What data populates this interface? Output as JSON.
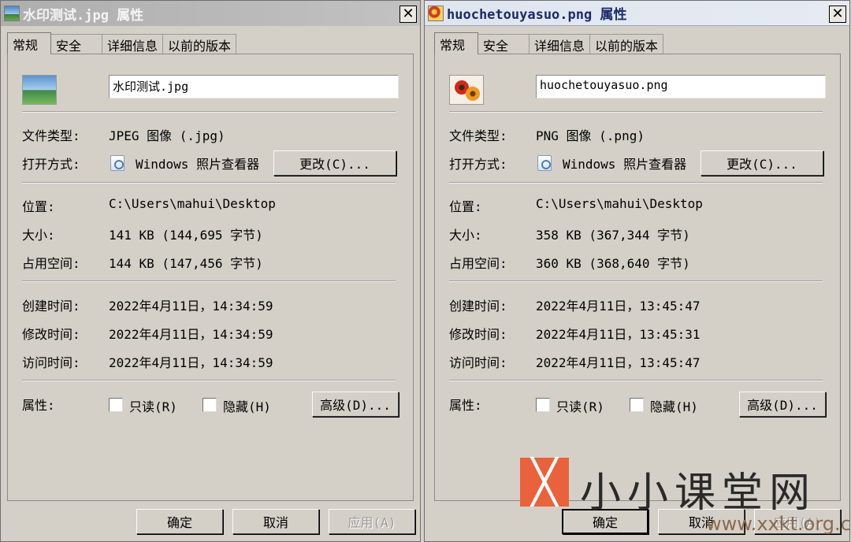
{
  "left_window": {
    "title": "水印测试.jpg 属性",
    "close_label": "✕",
    "tabs": [
      "常规",
      "安全",
      "详细信息",
      "以前的版本"
    ],
    "filename": "水印测试.jpg",
    "file_type_label": "文件类型:",
    "file_type_value": "JPEG 图像 (.jpg)",
    "opens_with_label": "打开方式:",
    "opens_with_value": "Windows 照片查看器",
    "change_button": "更改(C)...",
    "location_label": "位置:",
    "location_value": "C:\\Users\\mahui\\Desktop",
    "size_label": "大小:",
    "size_value": "141 KB (144,695 字节)",
    "size_on_disk_label": "占用空间:",
    "size_on_disk_value": "144 KB (147,456 字节)",
    "created_label": "创建时间:",
    "created_value": "2022年4月11日，14:34:59",
    "modified_label": "修改时间:",
    "modified_value": "2022年4月11日，14:34:59",
    "accessed_label": "访问时间:",
    "accessed_value": "2022年4月11日，14:34:59",
    "attributes_label": "属性:",
    "readonly_label": "只读(R)",
    "hidden_label": "隐藏(H)",
    "advanced_button": "高级(D)...",
    "ok_button": "确定",
    "cancel_button": "取消",
    "apply_button": "应用(A)"
  },
  "right_window": {
    "title": "huochetouyasuo.png 属性",
    "close_label": "✕",
    "tabs": [
      "常规",
      "安全",
      "详细信息",
      "以前的版本"
    ],
    "filename": "huochetouyasuo.png",
    "file_type_label": "文件类型:",
    "file_type_value": "PNG 图像 (.png)",
    "opens_with_label": "打开方式:",
    "opens_with_value": "Windows 照片查看器",
    "change_button": "更改(C)...",
    "location_label": "位置:",
    "location_value": "C:\\Users\\mahui\\Desktop",
    "size_label": "大小:",
    "size_value": "358 KB (367,344 字节)",
    "size_on_disk_label": "占用空间:",
    "size_on_disk_value": "360 KB (368,640 字节)",
    "created_label": "创建时间:",
    "created_value": "2022年4月11日，13:45:47",
    "modified_label": "修改时间:",
    "modified_value": "2022年4月11日，13:45:31",
    "accessed_label": "访问时间:",
    "accessed_value": "2022年4月11日，13:45:47",
    "attributes_label": "属性:",
    "readonly_label": "只读(R)",
    "hidden_label": "隐藏(H)",
    "advanced_button": "高级(D)...",
    "ok_button": "确定",
    "cancel_button": "取消",
    "apply_button": "应用(A)"
  },
  "watermark": {
    "logo_glyph": "╳",
    "text": "小小课堂网",
    "url": "www.xxkt.org.cn"
  }
}
